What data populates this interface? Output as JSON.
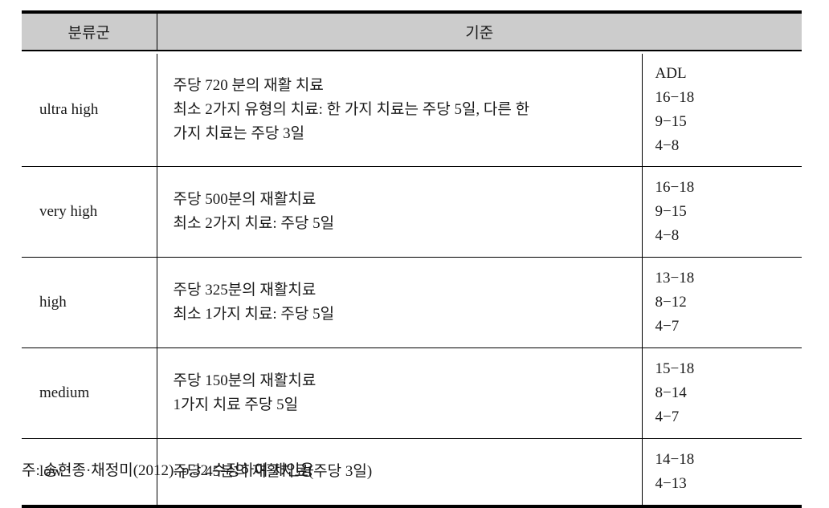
{
  "table": {
    "headers": {
      "group": "분류군",
      "criteria": "기준"
    },
    "rows": [
      {
        "group": "ultra high",
        "criteria_lines": [
          "주당 720 분의 재활 치료",
          "최소 2가지 유형의 치료: 한 가지 치료는 주당 5일, 다른 한",
          "가지 치료는 주당 3일"
        ],
        "adl_lines": [
          "ADL",
          "16−18",
          "9−15",
          "4−8"
        ]
      },
      {
        "group": "very high",
        "criteria_lines": [
          "주당 500분의 재활치료",
          "최소 2가지 치료: 주당 5일"
        ],
        "adl_lines": [
          "16−18",
          "9−15",
          "4−8"
        ]
      },
      {
        "group": "high",
        "criteria_lines": [
          "주당 325분의 재활치료",
          "최소 1가지 치료: 주당 5일"
        ],
        "adl_lines": [
          "13−18",
          "8−12",
          "4−7"
        ]
      },
      {
        "group": "medium",
        "criteria_lines": [
          "주당 150분의 재활치료",
          "1가지 치료 주당 5일"
        ],
        "adl_lines": [
          "15−18",
          "8−14",
          "4−7"
        ]
      },
      {
        "group": "low",
        "criteria_lines": [
          "주당 45분의 재활치료(주당 3일)"
        ],
        "adl_lines": [
          "14−18",
          "4−13"
        ]
      }
    ]
  },
  "footnote": "주: 송현종·채정미(2012). p.32 수정하여 재인용",
  "colors": {
    "header_background": "#cccccc",
    "border": "#000000",
    "text": "#1a1a1a",
    "page_background": "#ffffff"
  }
}
